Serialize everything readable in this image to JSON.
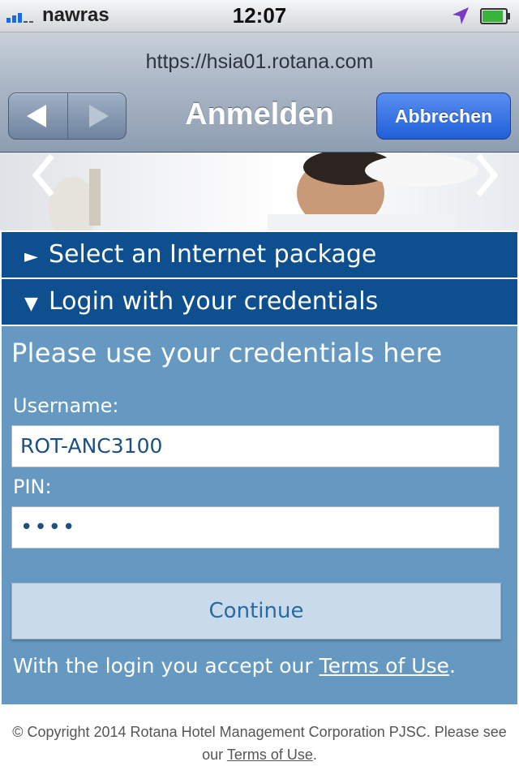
{
  "status_bar": {
    "carrier": "nawras",
    "time": "12:07",
    "battery_level": 0.9
  },
  "browser": {
    "url": "https://hsia01.rotana.com",
    "title": "Anmelden",
    "cancel_label": "Abbrechen"
  },
  "accordion": {
    "package_label": "Select an Internet package",
    "credentials_label": "Login with your credentials"
  },
  "login": {
    "heading": "Please use your credentials here",
    "username_label": "Username:",
    "username_value": "ROT-ANC3100",
    "pin_label": "PIN:",
    "pin_value": "••••",
    "continue_label": "Continue",
    "accept_text": "With the login you accept our",
    "terms_link": "Terms of Use",
    "accept_end": "."
  },
  "footer": {
    "copyright": "© Copyright 2014 Rotana Hotel Management Corporation PJSC. Please see",
    "our": "our",
    "terms_link": "Terms of Use",
    "end": "."
  },
  "colors": {
    "accordion_bg": "#0d4f8f",
    "panel_bg": "#6699c2",
    "cancel_button": "#1f5fd8"
  }
}
